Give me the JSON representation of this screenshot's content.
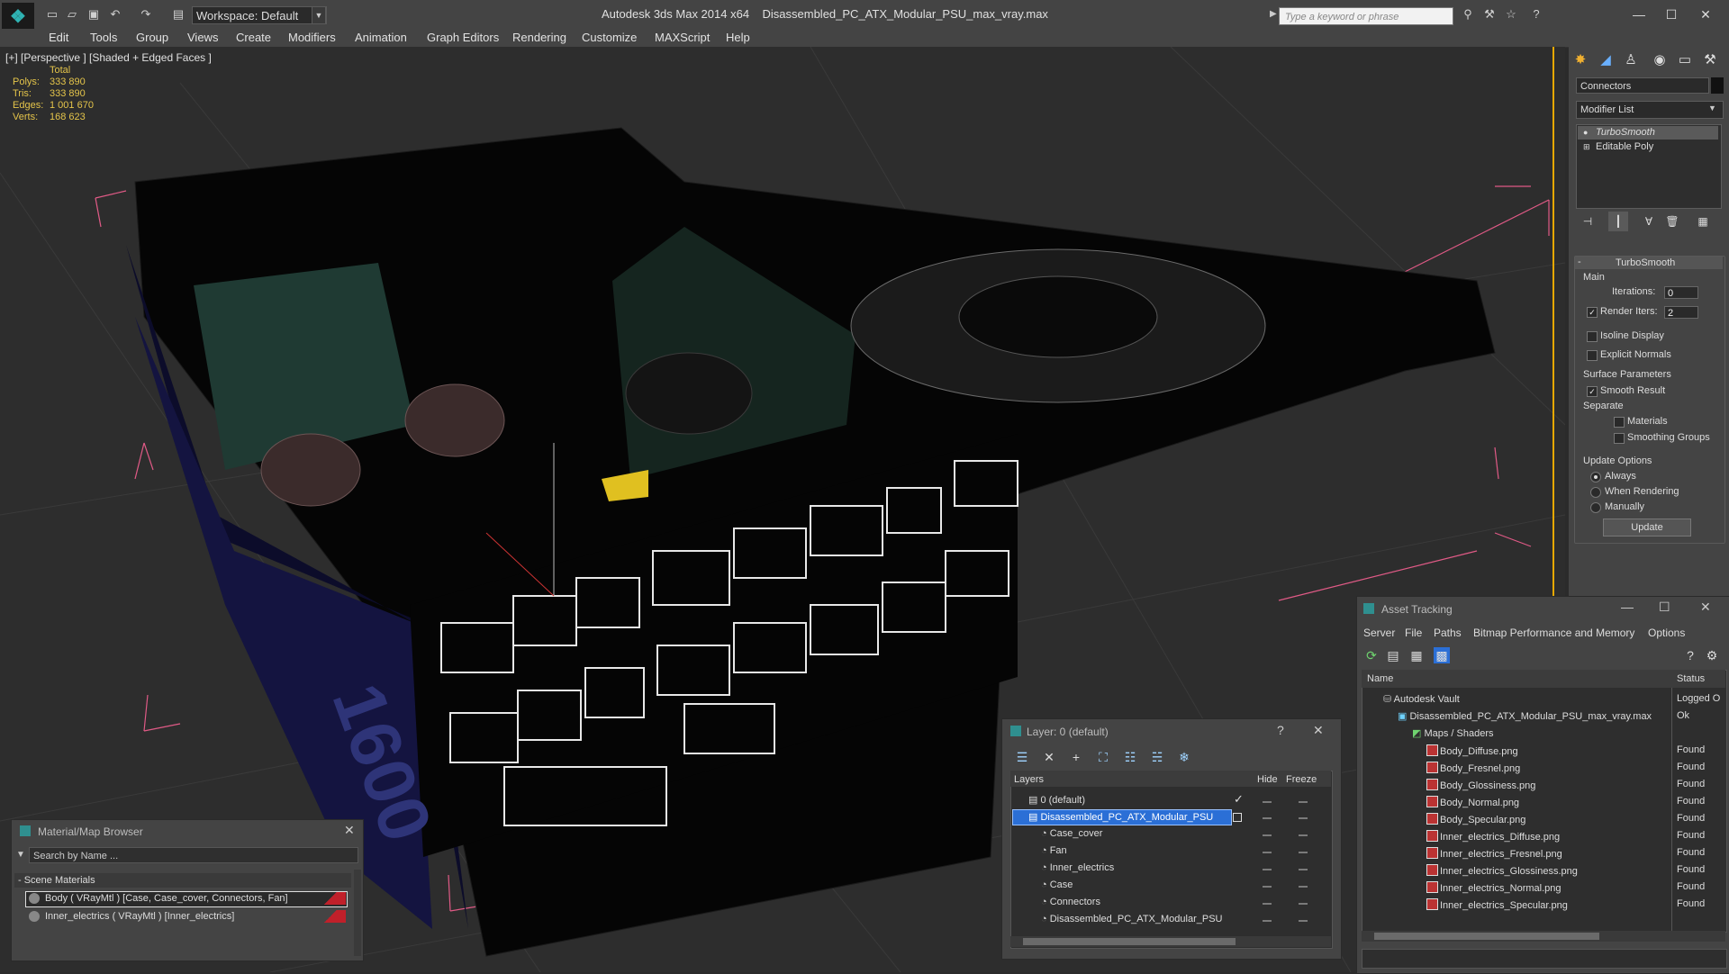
{
  "app": {
    "title": "Autodesk 3ds Max  2014 x64",
    "file": "Disassembled_PC_ATX_Modular_PSU_max_vray.max",
    "workspace": "Workspace: Default",
    "search_placeholder": "Type a keyword or phrase"
  },
  "menu": [
    "Edit",
    "Tools",
    "Group",
    "Views",
    "Create",
    "Modifiers",
    "Animation",
    "Graph Editors",
    "Rendering",
    "Customize",
    "MAXScript",
    "Help"
  ],
  "viewport": {
    "label": "[+] [Perspective ] [Shaded + Edged Faces ]",
    "stats": {
      "header": "Total",
      "rows": [
        {
          "label": "Polys:",
          "value": "333 890"
        },
        {
          "label": "Tris:",
          "value": "333 890"
        },
        {
          "label": "Edges:",
          "value": "1 001 670"
        },
        {
          "label": "Verts:",
          "value": "168 623"
        }
      ]
    },
    "psu_text": "1600"
  },
  "command_panel": {
    "object_name": "Connectors",
    "modifier_list": "Modifier List",
    "stack": [
      "TurboSmooth",
      "Editable Poly"
    ],
    "rollout_title": "TurboSmooth",
    "main_label": "Main",
    "iterations_label": "Iterations:",
    "iterations_value": "0",
    "render_iters_label": "Render Iters:",
    "render_iters_value": "2",
    "isoline": "Isoline Display",
    "explicit": "Explicit Normals",
    "surface_params": "Surface Parameters",
    "smooth_result": "Smooth Result",
    "separate": "Separate",
    "materials": "Materials",
    "smoothing_groups": "Smoothing Groups",
    "update_options": "Update Options",
    "always": "Always",
    "when_rendering": "When Rendering",
    "manually": "Manually",
    "update_button": "Update"
  },
  "material_browser": {
    "title": "Material/Map Browser",
    "search": "Search by Name ...",
    "group": "- Scene Materials",
    "items": [
      "Body  ( VRayMtl )  [Case, Case_cover, Connectors, Fan]",
      "Inner_electrics  ( VRayMtl )  [Inner_electrics]"
    ]
  },
  "layers": {
    "title": "Layer: 0 (default)",
    "help": "?",
    "col_layers": "Layers",
    "col_hide": "Hide",
    "col_freeze": "Freeze",
    "rows": [
      "0 (default)",
      "Disassembled_PC_ATX_Modular_PSU",
      "Case_cover",
      "Fan",
      "Inner_electrics",
      "Case",
      "Connectors",
      "Disassembled_PC_ATX_Modular_PSU"
    ]
  },
  "asset_tracking": {
    "title": "Asset Tracking",
    "menu": [
      "Server",
      "File",
      "Paths",
      "Bitmap Performance and Memory",
      "Options"
    ],
    "col_name": "Name",
    "col_status": "Status",
    "rows": [
      {
        "name": "Autodesk Vault",
        "status": "Logged O"
      },
      {
        "name": "Disassembled_PC_ATX_Modular_PSU_max_vray.max",
        "status": "Ok"
      },
      {
        "name": "Maps / Shaders",
        "status": ""
      },
      {
        "name": "Body_Diffuse.png",
        "status": "Found"
      },
      {
        "name": "Body_Fresnel.png",
        "status": "Found"
      },
      {
        "name": "Body_Glossiness.png",
        "status": "Found"
      },
      {
        "name": "Body_Normal.png",
        "status": "Found"
      },
      {
        "name": "Body_Specular.png",
        "status": "Found"
      },
      {
        "name": "Inner_electrics_Diffuse.png",
        "status": "Found"
      },
      {
        "name": "Inner_electrics_Fresnel.png",
        "status": "Found"
      },
      {
        "name": "Inner_electrics_Glossiness.png",
        "status": "Found"
      },
      {
        "name": "Inner_electrics_Normal.png",
        "status": "Found"
      },
      {
        "name": "Inner_electrics_Specular.png",
        "status": "Found"
      }
    ]
  },
  "colors": {
    "accent": "#2b6fd6",
    "stats": "#e4c44a",
    "viewport_border": "#e6a800",
    "selection": "#2b6fd6"
  }
}
